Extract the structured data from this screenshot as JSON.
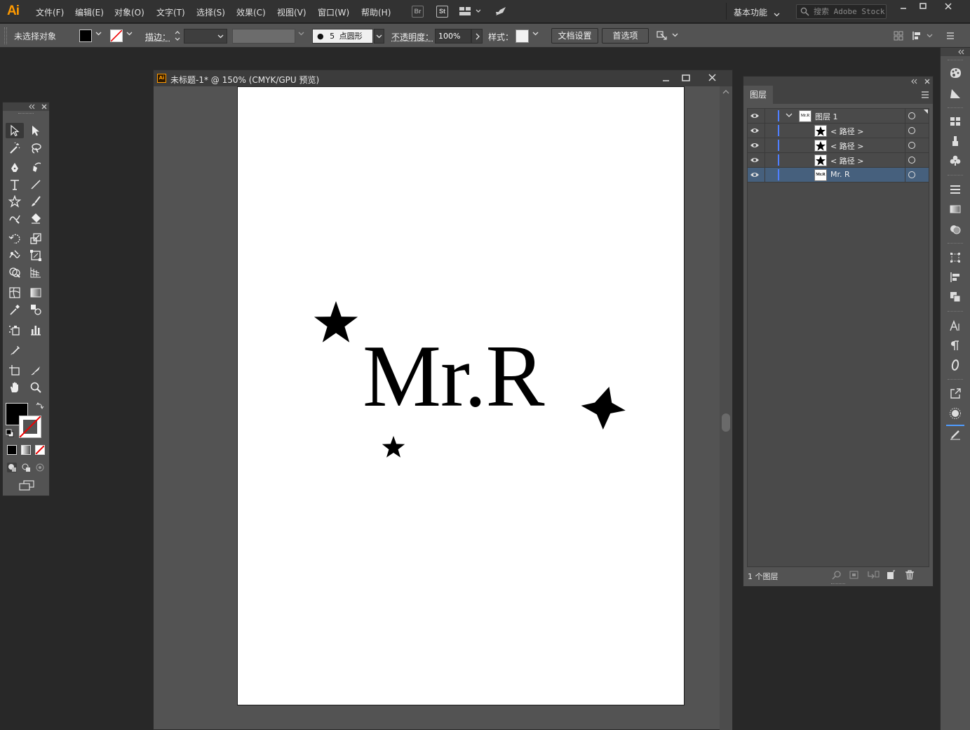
{
  "app": {
    "logo": "Ai",
    "menu": [
      "文件(F)",
      "编辑(E)",
      "对象(O)",
      "文字(T)",
      "选择(S)",
      "效果(C)",
      "视图(V)",
      "窗口(W)",
      "帮助(H)"
    ],
    "bridge_label": "Br",
    "stock_label": "St",
    "workspace": "基本功能",
    "search_placeholder": "搜索 Adobe Stock"
  },
  "control_bar": {
    "selection_status": "未选择对象",
    "stroke_label": "描边：",
    "brush_size": "5",
    "brush_shape": "点圆形",
    "opacity_label": "不透明度：",
    "opacity_value": "100%",
    "style_label": "样式：",
    "doc_setup_button": "文档设置",
    "preferences_button": "首选项"
  },
  "document": {
    "title": "未标题-1* @ 150% (CMYK/GPU 预览)",
    "artwork_text": "Mr.R"
  },
  "layers_panel": {
    "tab": "图层",
    "rows": [
      {
        "name": "图层 1",
        "thumb": "Mr.R",
        "kind": "layer",
        "selected": false
      },
      {
        "name": "< 路径 >",
        "thumb": "star",
        "kind": "path",
        "selected": false
      },
      {
        "name": "< 路径 >",
        "thumb": "star",
        "kind": "path",
        "selected": false
      },
      {
        "name": "< 路径 >",
        "thumb": "star",
        "kind": "path",
        "selected": false
      },
      {
        "name": "Mr. R",
        "thumb": "Mr.R",
        "kind": "text",
        "selected": true
      }
    ],
    "footer_count": "1 个图层"
  },
  "colors": {
    "accent": "#ff9a00",
    "selection": "#46607d",
    "layer_color": "#4f7fff"
  }
}
